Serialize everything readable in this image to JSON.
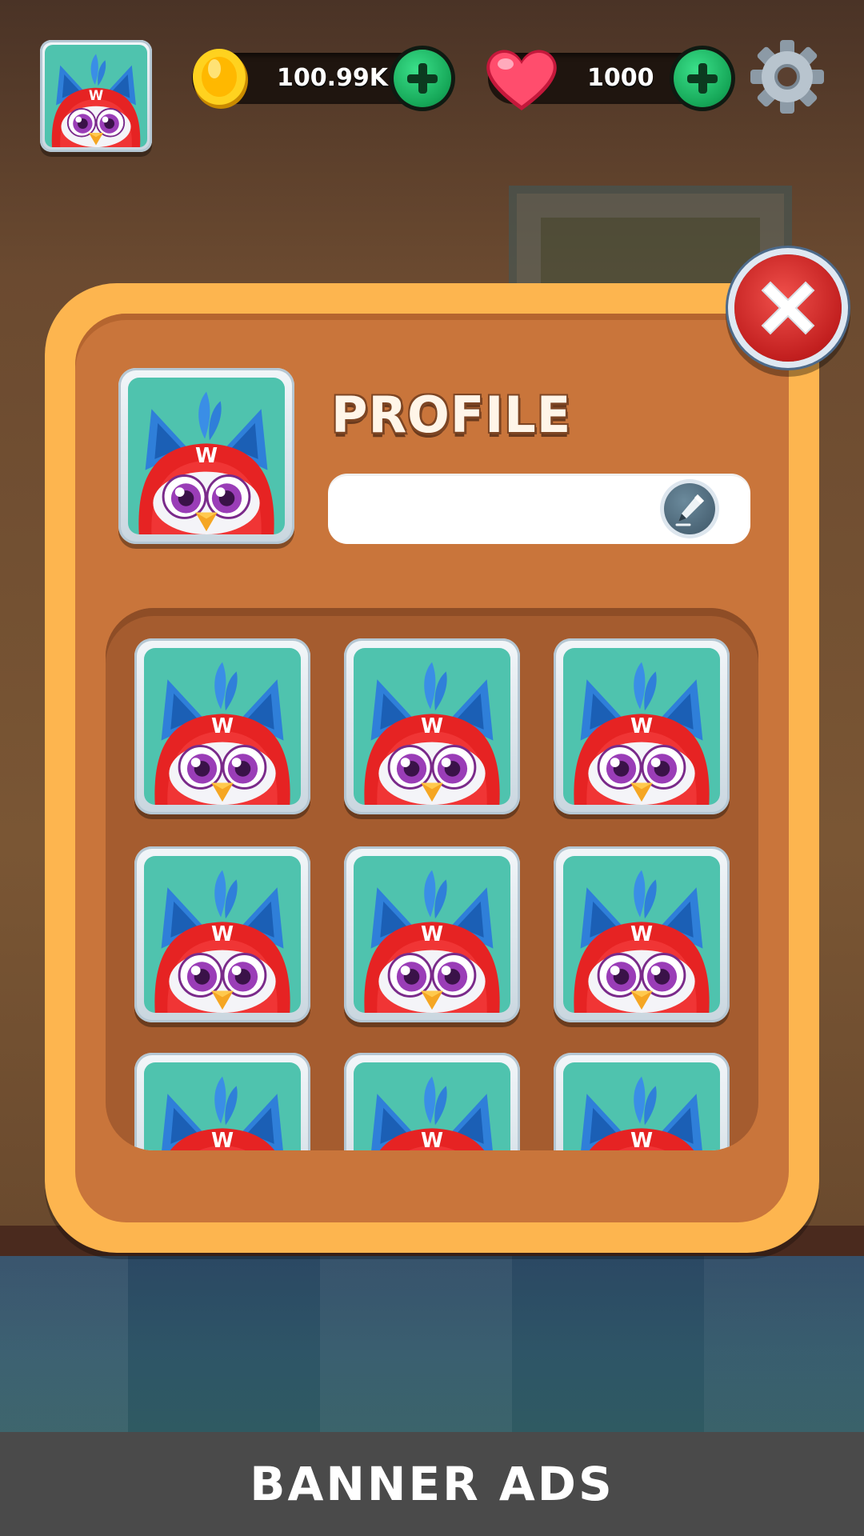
{
  "hud": {
    "coins": "100.99K",
    "lives": "1000"
  },
  "profile": {
    "title": "PROFILE",
    "name_value": "",
    "name_placeholder": ""
  },
  "avatar_grid": {
    "visible_count": 9,
    "columns": 3
  },
  "banner": {
    "label": "BANNER ADS"
  },
  "colors": {
    "panel_rim": "#fdb54f",
    "panel_fill": "#c9753b",
    "grid_well": "#a55c2f",
    "close_button": "#c21f1f",
    "plus_button": "#15a657",
    "banner_bg": "#4a4a4a"
  },
  "icons": {
    "coin": "coin-icon",
    "heart": "heart-icon",
    "settings": "gear-icon",
    "close": "close-icon",
    "edit": "pencil-icon",
    "avatar": "parrot-avatar-icon"
  }
}
